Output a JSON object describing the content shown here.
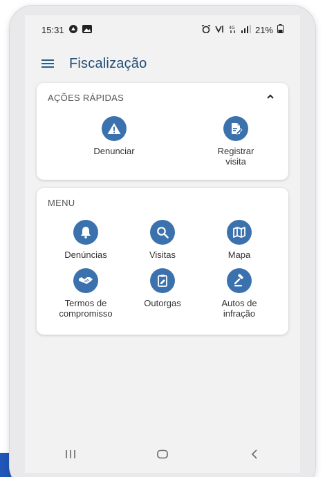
{
  "status_bar": {
    "time": "15:31",
    "battery": "21%"
  },
  "app_bar": {
    "title": "Fiscalização"
  },
  "quick_actions": {
    "title": "AÇÕES RÁPIDAS",
    "items": [
      {
        "label": "Denunciar",
        "icon": "warning-icon"
      },
      {
        "label": "Registrar\nvisita",
        "icon": "edit-document-icon"
      }
    ]
  },
  "menu": {
    "title": "MENU",
    "items": [
      {
        "label": "Denúncias",
        "icon": "bell-icon"
      },
      {
        "label": "Visitas",
        "icon": "search-icon"
      },
      {
        "label": "Mapa",
        "icon": "map-icon"
      },
      {
        "label": "Termos de\ncompromisso",
        "icon": "handshake-icon"
      },
      {
        "label": "Outorgas",
        "icon": "clipboard-edit-icon"
      },
      {
        "label": "Autos de\ninfração",
        "icon": "gavel-icon"
      }
    ]
  },
  "colors": {
    "accent": "#3b72ad",
    "title": "#234e78",
    "background": "#f2f2f2"
  }
}
